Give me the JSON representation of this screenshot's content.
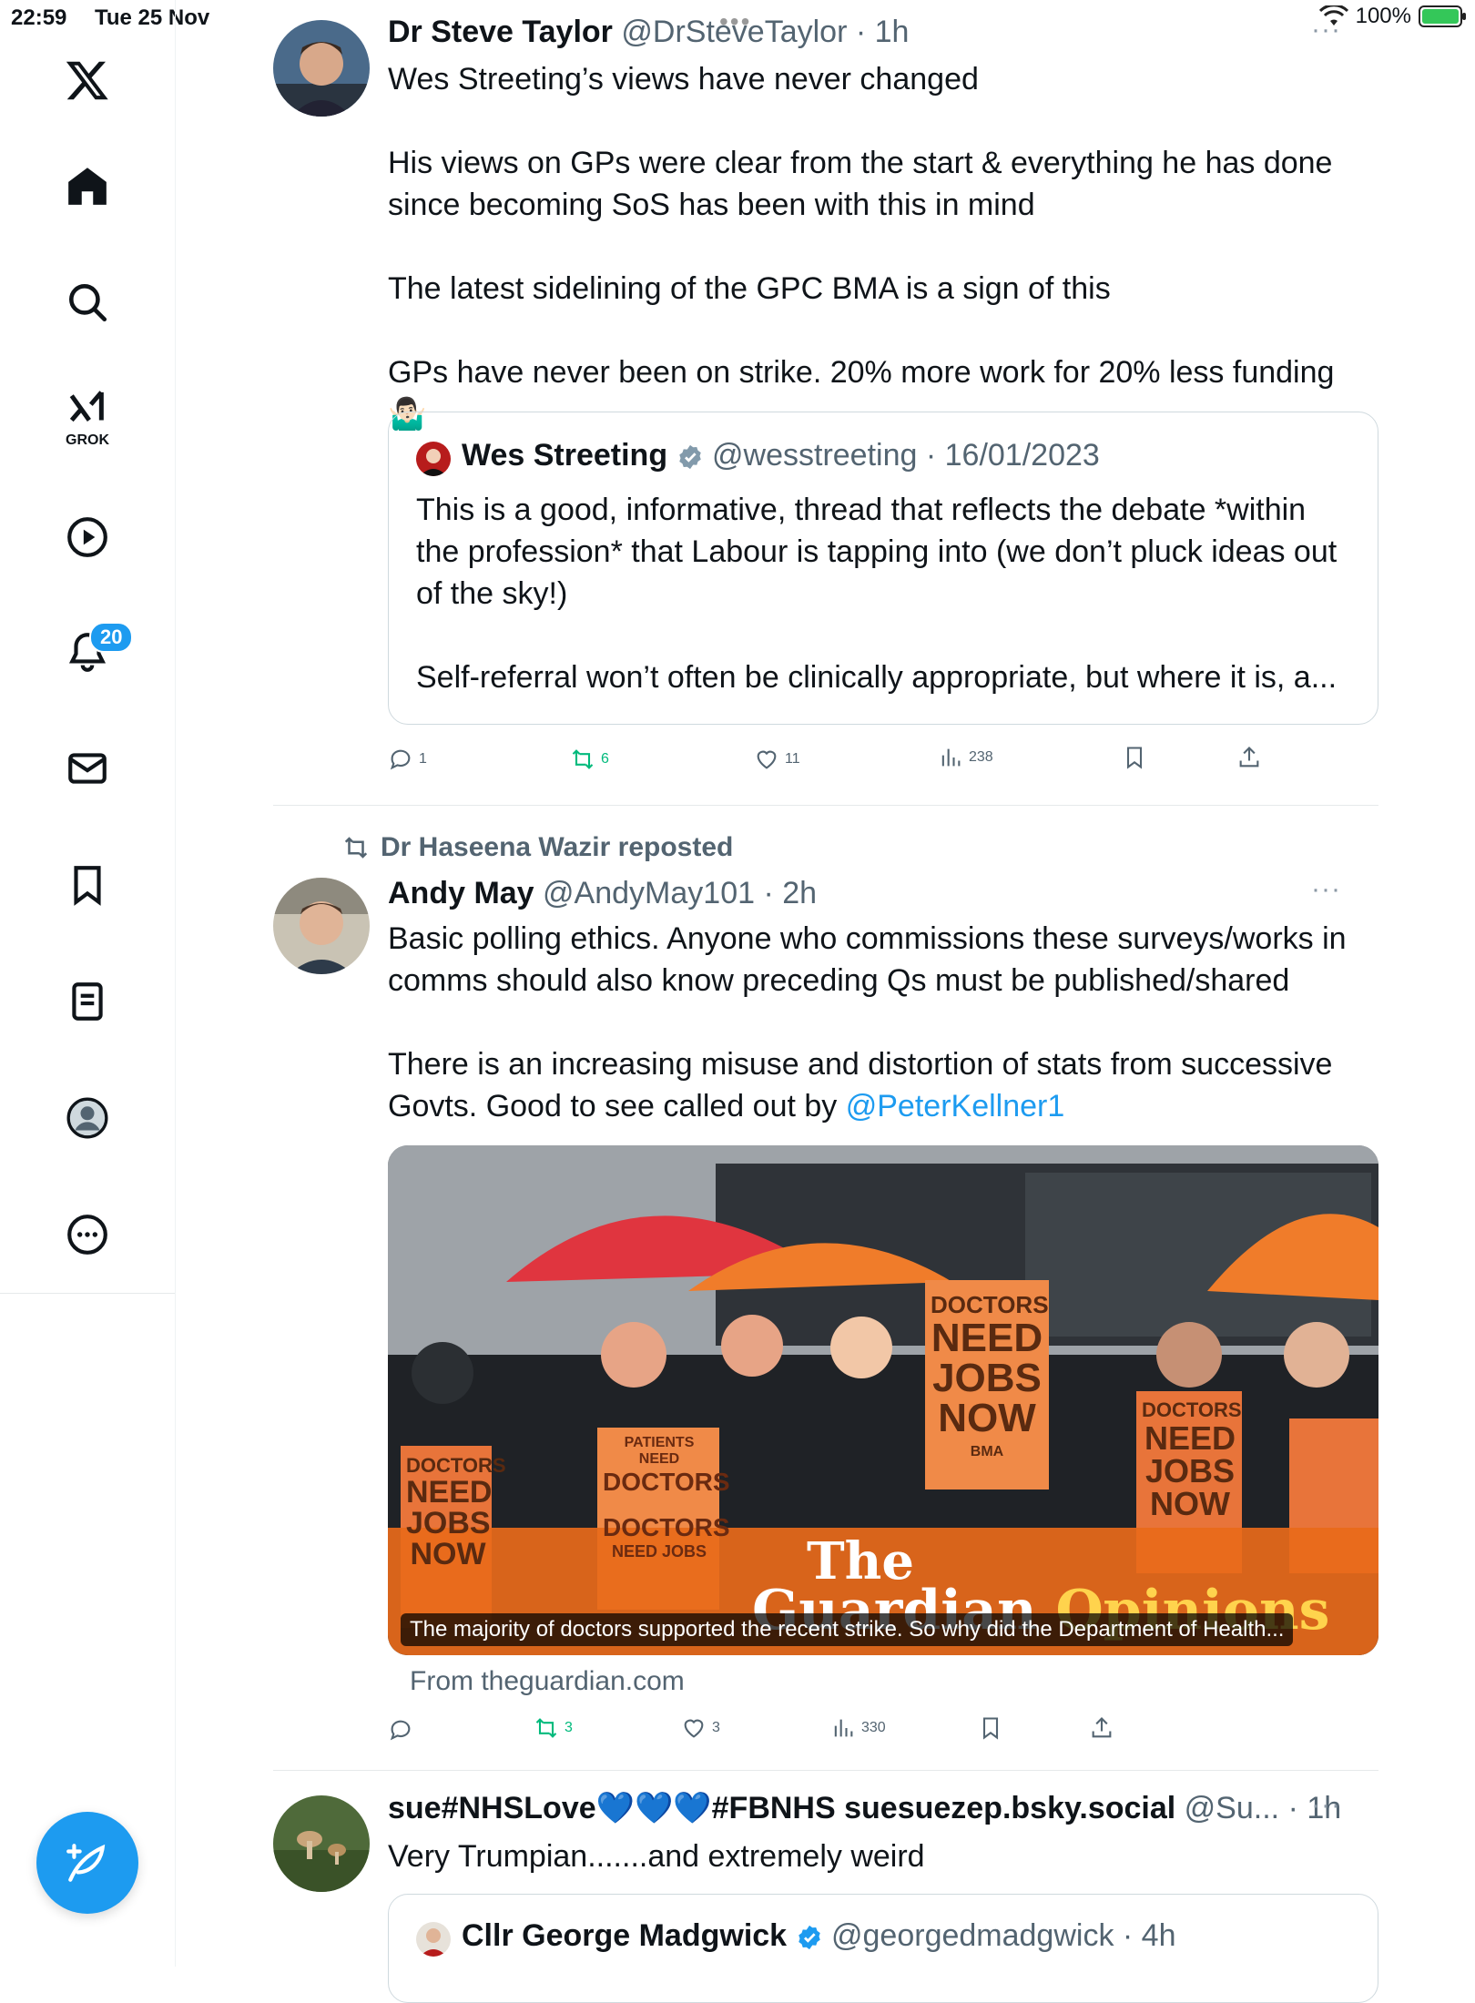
{
  "status_bar": {
    "time": "22:59",
    "date": "Tue 25 Nov",
    "battery": "100%",
    "battery_level": 1.0
  },
  "sidebar": {
    "items": [
      "X",
      "Home",
      "Explore",
      "Grok",
      "Video",
      "Notifications",
      "Messages",
      "Bookmarks",
      "Lists",
      "Profile",
      "More"
    ],
    "grok_label": "GROK",
    "notifications_count": "20"
  },
  "posts": [
    {
      "name": "Dr Steve Taylor",
      "handle": "@DrSteveTaylor",
      "time": "· 1h",
      "text": "Wes Streeting’s views have never changed\n\nHis views on GPs were clear from the start & everything he has done since becoming SoS has been with this in mind\n\nThe latest sidelining of the GPC BMA is a sign of this\n\nGPs have never been on strike. 20% more work for 20% less funding🤷🏻‍♂️",
      "quote": {
        "name": "Wes Streeting",
        "handle": "@wesstreeting",
        "time": "· 16/01/2023",
        "text": "This is a good, informative, thread that reflects the debate *within the profession* that Labour is tapping into (we don’t pluck ideas out of the sky!)\n\nSelf-referral won’t often be clinically appropriate, but where it is, a..."
      },
      "stats": {
        "replies": "1",
        "reposts": "6",
        "likes": "11",
        "views": "238"
      }
    },
    {
      "reposted_by": "Dr Haseena Wazir reposted",
      "name": "Andy May",
      "handle": "@AndyMay101",
      "time": "· 2h",
      "text_main": "Basic polling ethics. Anyone who commissions these surveys/works in comms should also know preceding Qs must be published/shared\n\nThere is an increasing misuse and distortion of stats from successive Govts. Good to see called out by ",
      "mention": "@PeterKellner1",
      "card": {
        "signs": {
          "s1": [
            "DOCTORS",
            "NEED",
            "JOBS",
            "NOW"
          ],
          "s2a": [
            "PATIENTS NEED",
            "DOCTORS"
          ],
          "s2b": [
            "DOCTORS",
            "NEED JOBS"
          ],
          "s3": [
            "DOCTORS",
            "NEED",
            "JOBS",
            "NOW"
          ],
          "s4": [
            "DOCTORS",
            "NEED",
            "JOBS",
            "NOW"
          ],
          "bma": "BMA"
        },
        "brand_line1": "The",
        "brand_line2": "Guardian",
        "brand_line3": "Opinions",
        "caption": "The majority of doctors supported the recent strike. So why did the Department of Health...",
        "from": "From theguardian.com"
      },
      "stats": {
        "replies": "",
        "reposts": "3",
        "likes": "3",
        "views": "330"
      }
    },
    {
      "name": "sue#NHSLove💙💙💙#FBNHS suesuezep.bsky.social",
      "handle": "@Su...",
      "time": "· 1h",
      "text": "Very Trumpian.......and extremely weird",
      "quote": {
        "name": "Cllr George Madgwick",
        "handle": "@georgedmadgwick",
        "time": "· 4h"
      }
    }
  ],
  "colors": {
    "accent": "#1d9bf0",
    "repost_green": "#00ba7c",
    "muted": "#536471"
  }
}
